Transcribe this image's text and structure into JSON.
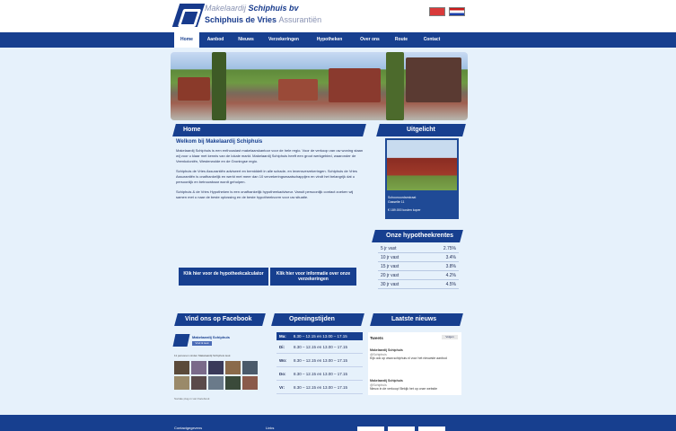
{
  "brand": {
    "line1_a": "Makelaardij",
    "line1_b": "Schiphuis bv",
    "line2_a": "Schiphuis de Vries",
    "line2_b": "Assurantiën"
  },
  "nav": [
    "Home",
    "Aanbod",
    "Nieuws",
    "Verzekeringen",
    "Hypotheken",
    "Over ons",
    "Route",
    "Contact"
  ],
  "section_home": "Home",
  "section_uitgelicht": "Uitgelicht",
  "section_rates": "Onze hypotheekrentes",
  "section_facebook": "Vind ons op Facebook",
  "section_hours": "Openingstijden",
  "section_news": "Laatste nieuws",
  "content": {
    "heading": "Welkom bij Makelaardij Schiphuis",
    "p1": "Makelaardij Schiphuis is een enthousiast makelaarskantoor voor de hele regio. Voor de verkoop van uw woning staan wij voor u klaar met kennis van de lokale markt. Makelaardij Schiphuis heeft een groot werkgebied, waaronder de Veenkoloniën, Westerwolde en de Groningse regio.",
    "p2": "Schiphuis de Vries Assurantiën adviseert en bemiddelt in alle schade- en levensverzekeringen. Schiphuis de Vries Assurantiën is onafhankelijk en werkt met meer dan 10 verzekeringsmaatschappijen en vindt het belangrijk dat u persoonlijk en betrouwbaar wordt geholpen.",
    "p3": "Schiphuis & de Vries Hypotheken is een onafhankelijk hypotheekadviseur. Vanuit persoonlijk contact zoeken wij samen met u naar de beste oplossing en de beste hypotheekvorm voor uw situatie."
  },
  "cta_left": "Klik hier voor de hypotheekcalculator",
  "cta_right": "Klik hier voor informatie over onze verzekeringen",
  "featured": {
    "line1": "Schoonoordsestraat",
    "line2": "Gasselte 11",
    "line3": "€ 189.000 kosten koper"
  },
  "rates": [
    {
      "term": "5 jr vast",
      "rate": "2.75%"
    },
    {
      "term": "10 jr vast",
      "rate": "3.4%"
    },
    {
      "term": "15 jr vast",
      "rate": "3.8%"
    },
    {
      "term": "20 jr vast",
      "rate": "4.2%"
    },
    {
      "term": "30 jr vast",
      "rate": "4.5%"
    }
  ],
  "facebook": {
    "page": "Makelaardij Schiphuis",
    "like": "Vind ik leuk",
    "likes_text": "11 personen vinden Makelaardij Schiphuis leuk",
    "plugin": "Sociale plug-in van Facebook"
  },
  "hours": {
    "head_day": "Ma:",
    "head_time": "8.30 – 12.15 en 13.00 – 17.15",
    "rows": [
      {
        "day": "Di:",
        "time": "8.30 – 12.15 en 13.00 – 17.15"
      },
      {
        "day": "Wo:",
        "time": "8.30 – 12.15 en 13.00 – 17.15"
      },
      {
        "day": "Do:",
        "time": "8.30 – 12.15 en 13.00 – 17.15"
      },
      {
        "day": "Vr:",
        "time": "8.30 – 12.15 en 13.00 – 17.15"
      }
    ]
  },
  "news": {
    "title": "Tweets",
    "follow": "Volgen",
    "tweet1_name": "Makelaardij Schiphuis",
    "tweet1_handle": "@Schiphuis",
    "tweet1_text": "Kijk ook op www.schiphuis.nl voor het nieuwste aanbod",
    "tweet2_name": "Makelaardij Schiphuis",
    "tweet2_handle": "@Schiphuis",
    "tweet2_text": "Nieuw in de verkoop! Bekijk het op onze website"
  },
  "footer": {
    "col1": "Contactgegevens",
    "col2": "Links"
  },
  "colors": {
    "accent": "#173f8f",
    "background": "#e6f1fb"
  }
}
